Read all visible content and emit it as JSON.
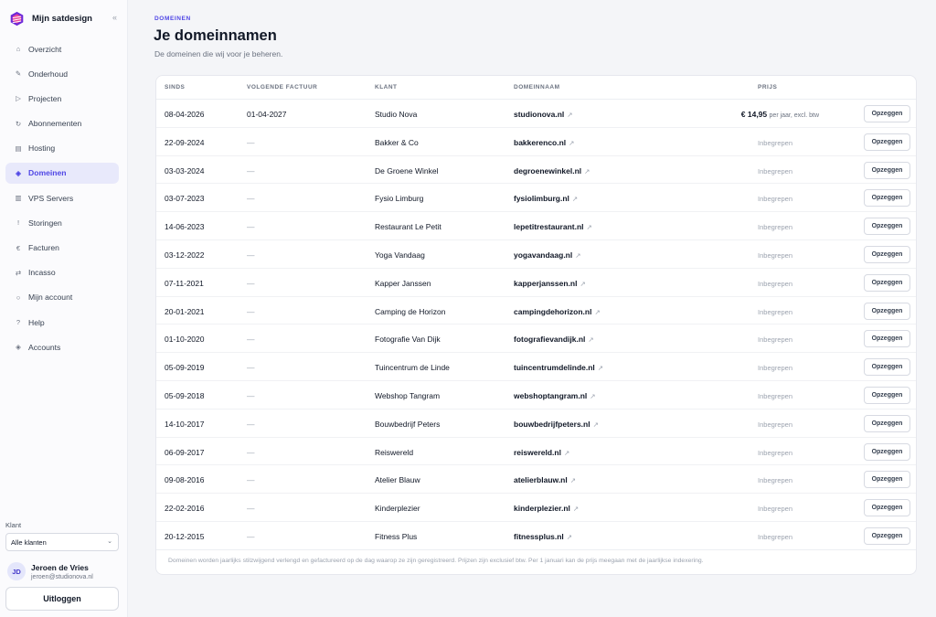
{
  "brand": {
    "name": "Mijn satdesign",
    "collapse_icon": "«"
  },
  "nav": [
    {
      "label": "Overzicht",
      "icon": "⌂",
      "icon_name": "home-icon",
      "active": false
    },
    {
      "label": "Onderhoud",
      "icon": "✎",
      "icon_name": "wrench-icon",
      "active": false
    },
    {
      "label": "Projecten",
      "icon": "▷",
      "icon_name": "play-icon",
      "active": false
    },
    {
      "label": "Abonnementen",
      "icon": "↻",
      "icon_name": "refresh-icon",
      "active": false
    },
    {
      "label": "Hosting",
      "icon": "▤",
      "icon_name": "server-icon",
      "active": false
    },
    {
      "label": "Domeinen",
      "icon": "◈",
      "icon_name": "globe-icon",
      "active": true
    },
    {
      "label": "VPS Servers",
      "icon": "▥",
      "icon_name": "vps-icon",
      "active": false
    },
    {
      "label": "Storingen",
      "icon": "!",
      "icon_name": "alert-icon",
      "active": false
    },
    {
      "label": "Facturen",
      "icon": "€",
      "icon_name": "euro-icon",
      "active": false
    },
    {
      "label": "Incasso",
      "icon": "⇄",
      "icon_name": "transfer-icon",
      "active": false
    },
    {
      "label": "Mijn account",
      "icon": "○",
      "icon_name": "user-icon",
      "active": false
    },
    {
      "label": "Help",
      "icon": "?",
      "icon_name": "help-icon",
      "active": false
    },
    {
      "label": "Accounts",
      "icon": "◈",
      "icon_name": "accounts-icon",
      "active": false
    }
  ],
  "klant": {
    "label": "Klant",
    "selected": "Alle klanten"
  },
  "user": {
    "initials": "JD",
    "name": "Jeroen de Vries",
    "email": "jeroen@studionova.nl"
  },
  "logout_label": "Uitloggen",
  "header": {
    "eyebrow": "DOMEINEN",
    "title": "Je domeinnamen",
    "subtitle": "De domeinen die wij voor je beheren."
  },
  "table": {
    "columns": {
      "since": "SINDS",
      "next_invoice": "VOLGENDE FACTUUR",
      "client": "KLANT",
      "domain": "DOMEINNAAM",
      "price": "PRIJS"
    },
    "cancel_label": "Opzeggen",
    "rows": [
      {
        "since": "08-04-2026",
        "next": "01-04-2027",
        "client": "Studio Nova",
        "domain": "studionova.nl",
        "price_amount": "€ 14,95",
        "price_note": "per jaar, excl. btw",
        "included": false
      },
      {
        "since": "22-09-2024",
        "next": "—",
        "client": "Bakker & Co",
        "domain": "bakkerenco.nl",
        "price_text": "Inbegrepen",
        "included": true
      },
      {
        "since": "03-03-2024",
        "next": "—",
        "client": "De Groene Winkel",
        "domain": "degroenewinkel.nl",
        "price_text": "Inbegrepen",
        "included": true
      },
      {
        "since": "03-07-2023",
        "next": "—",
        "client": "Fysio Limburg",
        "domain": "fysiolimburg.nl",
        "price_text": "Inbegrepen",
        "included": true
      },
      {
        "since": "14-06-2023",
        "next": "—",
        "client": "Restaurant Le Petit",
        "domain": "lepetitrestaurant.nl",
        "price_text": "Inbegrepen",
        "included": true
      },
      {
        "since": "03-12-2022",
        "next": "—",
        "client": "Yoga Vandaag",
        "domain": "yogavandaag.nl",
        "price_text": "Inbegrepen",
        "included": true
      },
      {
        "since": "07-11-2021",
        "next": "—",
        "client": "Kapper Janssen",
        "domain": "kapperjanssen.nl",
        "price_text": "Inbegrepen",
        "included": true
      },
      {
        "since": "20-01-2021",
        "next": "—",
        "client": "Camping de Horizon",
        "domain": "campingdehorizon.nl",
        "price_text": "Inbegrepen",
        "included": true
      },
      {
        "since": "01-10-2020",
        "next": "—",
        "client": "Fotografie Van Dijk",
        "domain": "fotografievandijk.nl",
        "price_text": "Inbegrepen",
        "included": true
      },
      {
        "since": "05-09-2019",
        "next": "—",
        "client": "Tuincentrum de Linde",
        "domain": "tuincentrumdelinde.nl",
        "price_text": "Inbegrepen",
        "included": true
      },
      {
        "since": "05-09-2018",
        "next": "—",
        "client": "Webshop Tangram",
        "domain": "webshoptangram.nl",
        "price_text": "Inbegrepen",
        "included": true
      },
      {
        "since": "14-10-2017",
        "next": "—",
        "client": "Bouwbedrijf Peters",
        "domain": "bouwbedrijfpeters.nl",
        "price_text": "Inbegrepen",
        "included": true
      },
      {
        "since": "06-09-2017",
        "next": "—",
        "client": "Reiswereld",
        "domain": "reiswereld.nl",
        "price_text": "Inbegrepen",
        "included": true
      },
      {
        "since": "09-08-2016",
        "next": "—",
        "client": "Atelier Blauw",
        "domain": "atelierblauw.nl",
        "price_text": "Inbegrepen",
        "included": true
      },
      {
        "since": "22-02-2016",
        "next": "—",
        "client": "Kinderplezier",
        "domain": "kinderplezier.nl",
        "price_text": "Inbegrepen",
        "included": true
      },
      {
        "since": "20-12-2015",
        "next": "—",
        "client": "Fitness Plus",
        "domain": "fitnessplus.nl",
        "price_text": "Inbegrepen",
        "included": true
      }
    ],
    "footnote": "Domeinen worden jaarlijks stilzwijgend verlengd en gefactureerd op de dag waarop ze zijn geregistreerd. Prijzen zijn exclusief btw. Per 1 januari kan de prijs meegaan met de jaarlijkse indexering."
  },
  "colors": {
    "accent": "#4f46e5",
    "active_bg": "#e8e9fb",
    "page_bg": "#f4f5f8"
  }
}
